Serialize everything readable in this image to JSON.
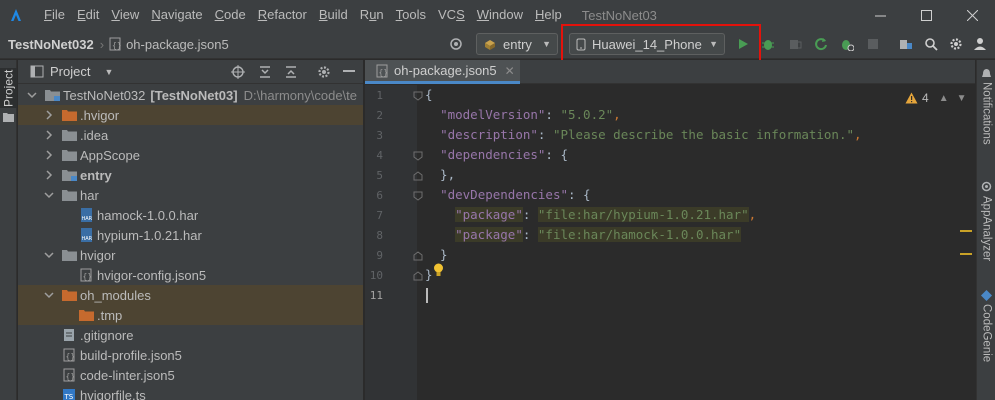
{
  "menu": {
    "items": [
      {
        "pre": "",
        "u": "F",
        "post": "ile"
      },
      {
        "pre": "",
        "u": "E",
        "post": "dit"
      },
      {
        "pre": "",
        "u": "V",
        "post": "iew"
      },
      {
        "pre": "",
        "u": "N",
        "post": "avigate"
      },
      {
        "pre": "",
        "u": "C",
        "post": "ode"
      },
      {
        "pre": "",
        "u": "R",
        "post": "efactor"
      },
      {
        "pre": "",
        "u": "B",
        "post": "uild"
      },
      {
        "pre": "R",
        "u": "u",
        "post": "n"
      },
      {
        "pre": "",
        "u": "T",
        "post": "ools"
      },
      {
        "pre": "VC",
        "u": "S",
        "post": ""
      },
      {
        "pre": "",
        "u": "W",
        "post": "indow"
      },
      {
        "pre": "",
        "u": "H",
        "post": "elp"
      }
    ],
    "window_title": "TestNoNet03"
  },
  "nav": {
    "project": "TestNoNet032",
    "file": "oh-package.json5",
    "module_combo": "entry",
    "device_combo": "Huawei_14_Phone"
  },
  "left_strip": {
    "label": "Project"
  },
  "project_panel": {
    "title": "Project",
    "tree": [
      {
        "label": "TestNoNet032",
        "suffix": "[TestNoNet03]",
        "path": "D:\\harmony\\code\\te",
        "depth": 0,
        "expanded": true,
        "icon": "folder-module",
        "highlight": false
      },
      {
        "label": ".hvigor",
        "depth": 1,
        "expanded": false,
        "icon": "folder-orange",
        "highlight": true
      },
      {
        "label": ".idea",
        "depth": 1,
        "expanded": false,
        "icon": "folder-gray",
        "highlight": false
      },
      {
        "label": "AppScope",
        "depth": 1,
        "expanded": false,
        "icon": "folder-gray",
        "highlight": false
      },
      {
        "label": "entry",
        "depth": 1,
        "expanded": false,
        "icon": "folder-module",
        "highlight": false,
        "bold": true
      },
      {
        "label": "har",
        "depth": 1,
        "expanded": true,
        "icon": "folder-gray",
        "highlight": false
      },
      {
        "label": "hamock-1.0.0.har",
        "depth": 2,
        "icon": "har-file",
        "highlight": false
      },
      {
        "label": "hypium-1.0.21.har",
        "depth": 2,
        "icon": "har-file",
        "highlight": false
      },
      {
        "label": "hvigor",
        "depth": 1,
        "expanded": true,
        "icon": "folder-gray",
        "highlight": false
      },
      {
        "label": "hvigor-config.json5",
        "depth": 2,
        "icon": "json-file",
        "highlight": false
      },
      {
        "label": "oh_modules",
        "depth": 1,
        "expanded": true,
        "icon": "folder-orange",
        "highlight": true
      },
      {
        "label": ".tmp",
        "depth": 2,
        "icon": "folder-orange",
        "highlight": true
      },
      {
        "label": ".gitignore",
        "depth": 1,
        "icon": "text-file",
        "highlight": false
      },
      {
        "label": "build-profile.json5",
        "depth": 1,
        "icon": "json-file",
        "highlight": false
      },
      {
        "label": "code-linter.json5",
        "depth": 1,
        "icon": "json-file",
        "highlight": false
      },
      {
        "label": "hvigorfile.ts",
        "depth": 1,
        "icon": "ts-file",
        "highlight": false
      }
    ]
  },
  "editor": {
    "tab_label": "oh-package.json5",
    "warnings": "4",
    "line_numbers": [
      "1",
      "2",
      "3",
      "4",
      "5",
      "6",
      "7",
      "8",
      "9",
      "10",
      "11"
    ],
    "lines": [
      [
        {
          "t": "{",
          "c": "plain"
        }
      ],
      [
        {
          "t": "  ",
          "c": "plain"
        },
        {
          "t": "\"modelVersion\"",
          "c": "k"
        },
        {
          "t": ": ",
          "c": "plain"
        },
        {
          "t": "\"5.0.2\"",
          "c": "s"
        },
        {
          "t": ",",
          "c": "p"
        }
      ],
      [
        {
          "t": "  ",
          "c": "plain"
        },
        {
          "t": "\"description\"",
          "c": "k"
        },
        {
          "t": ": ",
          "c": "plain"
        },
        {
          "t": "\"Please describe the basic information.\"",
          "c": "s"
        },
        {
          "t": ",",
          "c": "p"
        }
      ],
      [
        {
          "t": "  ",
          "c": "plain"
        },
        {
          "t": "\"dependencies\"",
          "c": "k"
        },
        {
          "t": ": {",
          "c": "plain"
        }
      ],
      [
        {
          "t": "  },",
          "c": "plain"
        }
      ],
      [
        {
          "t": "  ",
          "c": "plain"
        },
        {
          "t": "\"devDependencies\"",
          "c": "k"
        },
        {
          "t": ": {",
          "c": "plain"
        }
      ],
      [
        {
          "t": "    ",
          "c": "plain"
        },
        {
          "t": "\"package\"",
          "c": "k",
          "h": true
        },
        {
          "t": ": ",
          "c": "plain"
        },
        {
          "t": "\"file:har/hypium-1.0.21.har\"",
          "c": "s",
          "h": true
        },
        {
          "t": ",",
          "c": "p"
        }
      ],
      [
        {
          "t": "    ",
          "c": "plain"
        },
        {
          "t": "\"package\"",
          "c": "k",
          "h": true
        },
        {
          "t": ": ",
          "c": "plain"
        },
        {
          "t": "\"file:har/hamock-1.0.0.har\"",
          "c": "s",
          "h": true
        }
      ],
      [
        {
          "t": "  }",
          "c": "plain"
        }
      ],
      [
        {
          "t": "}",
          "c": "plain"
        }
      ],
      [
        {
          "t": "",
          "c": "plain"
        }
      ]
    ]
  },
  "right_strip": {
    "labels": [
      "Notifications",
      "AppAnalyzer",
      "CodeGenie"
    ]
  },
  "colors": {
    "accent": "#4a88c7",
    "highlight_box": "#e3120b",
    "run_green": "#499c54"
  }
}
